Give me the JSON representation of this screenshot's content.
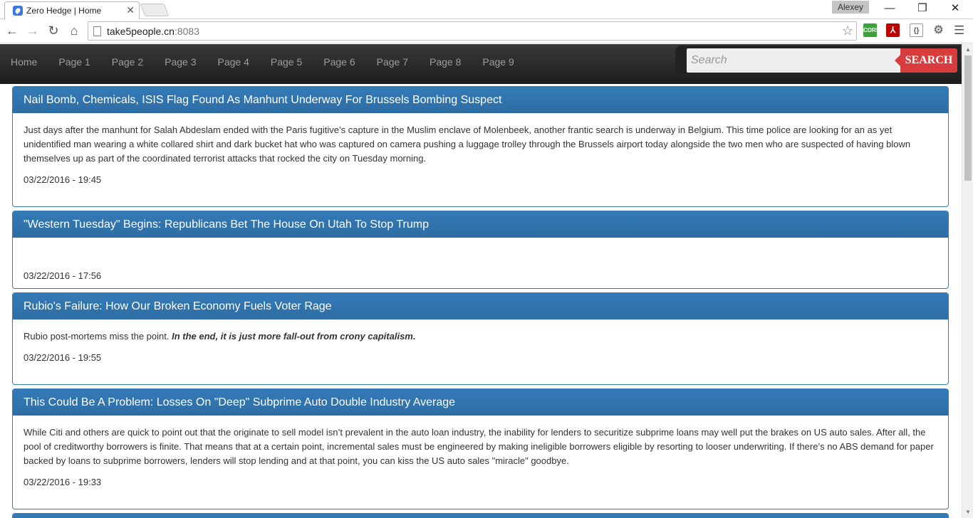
{
  "browser": {
    "tab_title": "Zero Hedge | Home",
    "tab_close": "✕",
    "user": "Alexey",
    "url_host": "take5people.cn",
    "url_port": ":8083",
    "window_min": "—",
    "window_max": "❐",
    "window_close": "✕",
    "back": "←",
    "forward": "→",
    "reload": "↻",
    "home": "⌂",
    "star": "☆",
    "menu": "☰",
    "ext_cors": "CORS",
    "ext_pdf": "⅄",
    "ext_doc": "{}",
    "ext_gear": "⚙"
  },
  "nav": {
    "links": [
      "Home",
      "Page 1",
      "Page 2",
      "Page 3",
      "Page 4",
      "Page 5",
      "Page 6",
      "Page 7",
      "Page 8",
      "Page 9"
    ],
    "search_placeholder": "Search",
    "search_button": "SEARCH"
  },
  "articles": [
    {
      "title": "Nail Bomb, Chemicals, ISIS Flag Found As Manhunt Underway For Brussels Bombing Suspect",
      "body": "Just days after the manhunt for Salah Abdeslam ended with the Paris fugitive’s capture in the Muslim enclave of Molenbeek, another frantic search is underway in Belgium. This time police are looking for an as yet unidentified man wearing a white collared shirt and dark bucket hat who was captured on camera pushing a luggage trolley through the Brussels airport today alongside the two men who are suspected of having blown themselves up as part of the coordinated terrorist attacks that rocked the city on Tuesday morning.",
      "date": "03/22/2016 - 19:45"
    },
    {
      "title": "\"Western Tuesday\" Begins: Republicans Bet The House On Utah To Stop Trump",
      "body": "",
      "date": "03/22/2016 - 17:56"
    },
    {
      "title": "Rubio's Failure: How Our Broken Economy Fuels Voter Rage",
      "body": "Rubio post-mortems miss the point.",
      "body_emphasis": "In the end, it is just more fall-out from crony capitalism.",
      "date": "03/22/2016 - 19:55"
    },
    {
      "title": "This Could Be A Problem: Losses On \"Deep\" Subprime Auto Double Industry Average",
      "body": "While Citi and others are quick to point out that the originate to sell model isn’t prevalent in the auto loan industry, the inability for lenders to securitize subprime loans may well put the brakes on US auto sales. After all, the pool of creditworthy borrowers is finite. That means that at a certain point, incremental sales must be engineered by making ineligible borrowers eligible by resorting to looser underwriting. If there’s no ABS demand for paper backed by loans to subprime borrowers, lenders will stop lending and at that point, you can kiss the US auto sales \"miracle\" goodbye.",
      "date": "03/22/2016 - 19:33"
    },
    {
      "title": "",
      "body": "",
      "date": ""
    }
  ],
  "scrollbar": {
    "up": "▲",
    "down": "▼"
  }
}
